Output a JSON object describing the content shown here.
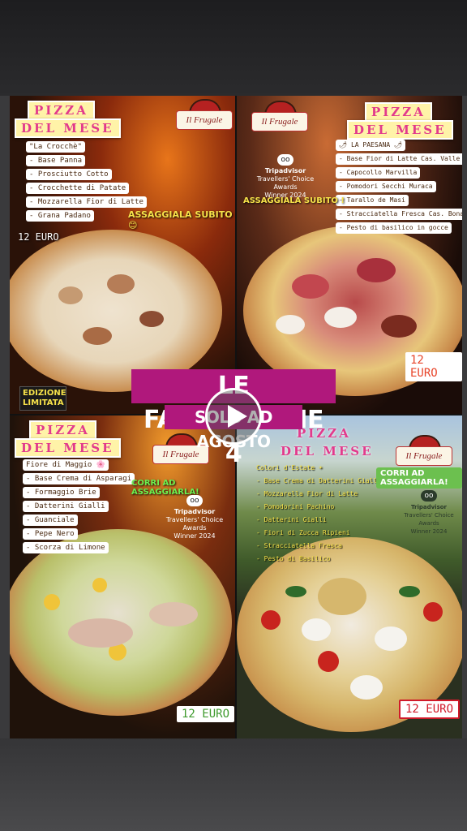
{
  "overlay": {
    "title": "LE FANTASTICHE 4",
    "subtitle": "SOLO AD AGOSTO"
  },
  "tiles": [
    {
      "heading_top": "PIZZA",
      "heading_bottom": "DEL MESE",
      "lines": [
        "\"La Crocchè\"",
        "- Base Panna",
        "- Prosciutto Cotto",
        "- Crocchette di Patate",
        "- Mozzarella Fior di Latte",
        "- Grana Padano"
      ],
      "logo": "Il Frugale",
      "callout": "ASSAGGIALA SUBITO 😊",
      "price": "12 EURO",
      "badge": "EDIZIONE LIMITATA"
    },
    {
      "heading_top": "PIZZA",
      "heading_bottom": "DEL MESE",
      "lines": [
        "🌶 LA PAESANA 🌶",
        "- Base Fior di Latte Cas. Valle Amato",
        "- Capocollo Marvilla",
        "- Pomodori Secchi Muraca",
        "- Tarallo de Masi",
        "- Stracciatella Fresca Cas. Bonaparte",
        "- Pesto di basilico in gocce"
      ],
      "logo": "Il Frugale",
      "tripadvisor": [
        "Tripadvisor",
        "Travellers' Choice Awards",
        "Winner 2024"
      ],
      "callout": "ASSAGGIALA SUBITO !",
      "price": "12 EURO"
    },
    {
      "heading_top": "PIZZA",
      "heading_bottom": "DEL MESE",
      "lines": [
        "Fiore di Maggio 🌸",
        "- Base Crema di Asparagi",
        "- Formaggio Brie",
        "- Datterini Gialli",
        "- Guanciale",
        "- Pepe Nero",
        "- Scorza di Limone"
      ],
      "logo": "Il Frugale",
      "callout": "CORRI AD ASSAGGIARLA!",
      "tripadvisor": [
        "Tripadvisor",
        "Travellers' Choice Awards",
        "Winner 2024"
      ],
      "price": "12 EURO"
    },
    {
      "heading_top": "PIZZA",
      "heading_bottom": "DEL MESE",
      "lines": [
        "Colori d'Estate ☀",
        "- Base Crema di Datterini Gialli",
        "- Mozzarella Fior di Latte",
        "- Pomodorini Pachino",
        "- Datterini Gialli",
        "- Fiori di Zucca Ripieni",
        "- Stracciatella Fresca",
        "- Pesto di Basilico"
      ],
      "logo": "Il Frugale",
      "callout": "CORRI AD ASSAGGIARLA!",
      "tripadvisor": [
        "Tripadvisor",
        "Travellers' Choice Awards",
        "Winner 2024"
      ],
      "price": "12 EURO"
    }
  ],
  "colors": {
    "heading_pink": "#e23a8c",
    "overlay_magenta": "#b0187c",
    "callout_yellow": "#f6e24a",
    "callout_green": "#6cf04f",
    "price_orange": "#e8452a",
    "price_green": "#3f9a2e",
    "price_red": "#d11a2a"
  },
  "icons": [
    "play-icon",
    "tripadvisor-owl-icon",
    "restaurant-logo-icon"
  ]
}
